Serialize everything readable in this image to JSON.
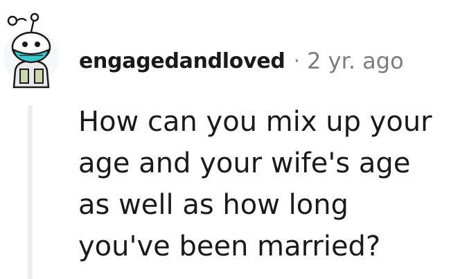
{
  "comment": {
    "author": "engagedandloved",
    "separator": "·",
    "timestamp": "2 yr. ago",
    "body": "How can you mix up your\nage and your wife's age\nas well as how long\nyou've been married?"
  },
  "avatar": {
    "icon": "snoo-avatar-icon",
    "mask_color": "#3fc4c8",
    "outline_color": "#1a1a1b"
  },
  "colors": {
    "text": "#1a1a1b",
    "meta": "#7c7c7c",
    "thread_line": "#ededed"
  }
}
